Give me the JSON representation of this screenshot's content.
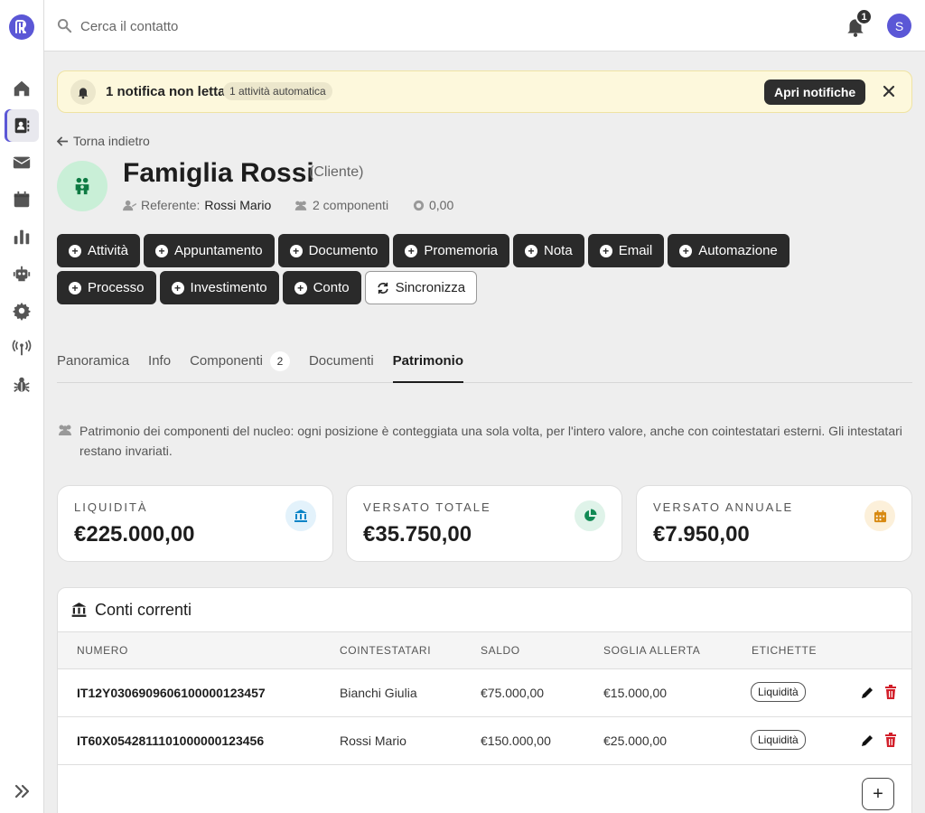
{
  "topbar": {
    "search_placeholder": "Cerca il contatto",
    "notification_count": "1",
    "avatar_initial": "S"
  },
  "banner": {
    "title": "1 notifica non letta",
    "pill": "1 attività automatica",
    "button": "Apri notifiche"
  },
  "header": {
    "back": "Torna indietro",
    "title": "Famiglia Rossi",
    "subtitle": "(Cliente)",
    "referente_label": "Referente:",
    "referente_value": "Rossi Mario",
    "componenti": "2 componenti",
    "balance": "0,00"
  },
  "actions": [
    {
      "label": "Attività"
    },
    {
      "label": "Appuntamento"
    },
    {
      "label": "Documento"
    },
    {
      "label": "Promemoria"
    },
    {
      "label": "Nota"
    },
    {
      "label": "Email"
    },
    {
      "label": "Automazione"
    },
    {
      "label": "Processo"
    },
    {
      "label": "Investimento"
    },
    {
      "label": "Conto"
    },
    {
      "label": "Sincronizza"
    }
  ],
  "tabs": [
    {
      "label": "Panoramica"
    },
    {
      "label": "Info"
    },
    {
      "label": "Componenti",
      "badge": "2"
    },
    {
      "label": "Documenti"
    },
    {
      "label": "Patrimonio"
    }
  ],
  "note": "Patrimonio dei componenti del nucleo: ogni posizione è conteggiata una sola volta, per l'intero valore, anche con cointestatari esterni. Gli intestatari restano invariati.",
  "cards": [
    {
      "label": "LIQUIDITÀ",
      "value": "€225.000,00",
      "icon": "bank-icon",
      "color": "#0a84c7",
      "bg": "#e3f2fb"
    },
    {
      "label": "VERSATO TOTALE",
      "value": "€35.750,00",
      "icon": "pie-chart-icon",
      "color": "#128a55",
      "bg": "#dff3e9"
    },
    {
      "label": "VERSATO ANNUALE",
      "value": "€7.950,00",
      "icon": "calendar-icon",
      "color": "#d88a12",
      "bg": "#fcf0da"
    }
  ],
  "accounts": {
    "title": "Conti correnti",
    "columns": [
      "NUMERO",
      "COINTESTATARI",
      "SALDO",
      "SOGLIA ALLERTA",
      "ETICHETTE"
    ],
    "rows": [
      {
        "numero": "IT12Y0306909606100000123457",
        "cointestatari": "Bianchi Giulia",
        "saldo": "€75.000,00",
        "soglia": "€15.000,00",
        "etichetta": "Liquidità"
      },
      {
        "numero": "IT60X0542811101000000123456",
        "cointestatari": "Rossi Mario",
        "saldo": "€150.000,00",
        "soglia": "€25.000,00",
        "etichetta": "Liquidità"
      }
    ],
    "add_label": "+"
  },
  "colors": {
    "accent": "#5b57d6",
    "danger": "#d21f2a",
    "banner_bg": "#fdf8dc"
  }
}
